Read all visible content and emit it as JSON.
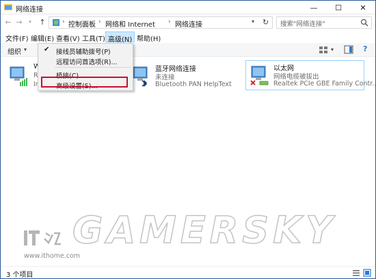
{
  "window": {
    "title": "网络连接",
    "controls": {
      "minimize": "—",
      "maximize": "☐",
      "close": "✕"
    }
  },
  "address": {
    "crumbs": [
      "控制面板",
      "网络和 Internet",
      "网络连接"
    ],
    "separator": "›"
  },
  "search": {
    "placeholder": "搜索\"网络连接\""
  },
  "menubar": {
    "items": [
      {
        "label": "文件(F)"
      },
      {
        "label": "编辑(E)"
      },
      {
        "label": "查看(V)"
      },
      {
        "label": "工具(T)"
      },
      {
        "label": "高级(N)",
        "active": true
      },
      {
        "label": "帮助(H)"
      }
    ]
  },
  "commandbar": {
    "organize_label": "组织"
  },
  "advanced_menu": {
    "items": [
      {
        "label": "接线员辅助拨号(P)",
        "checked": true
      },
      {
        "label": "远程访问首选项(R)..."
      },
      {
        "label": "桥接(C)"
      },
      {
        "label": "高级设置(S)...",
        "highlighted": true
      }
    ]
  },
  "connections": [
    {
      "name": "W",
      "status": "R",
      "device": "In",
      "icon": "wifi-adapter-icon"
    },
    {
      "name": "蓝牙网络连接",
      "status": "未连接",
      "device": "Bluetooth PAN HelpText",
      "icon": "bluetooth-adapter-icon"
    },
    {
      "name": "以太网",
      "status": "网络电缆被拔出",
      "device": "Realtek PCIe GBE Family Contr...",
      "icon": "ethernet-adapter-icon",
      "selected": true
    }
  ],
  "watermark": {
    "text": "GAMERSKY",
    "site_logo": "IT之家",
    "site_url": "www.ithome.com"
  },
  "statusbar": {
    "count": "3 个项目"
  },
  "colors": {
    "accent": "#2b579a",
    "menu_active_bg": "#cce8ff",
    "highlight_red": "#c8102e",
    "selection_border": "#99d1ff"
  }
}
